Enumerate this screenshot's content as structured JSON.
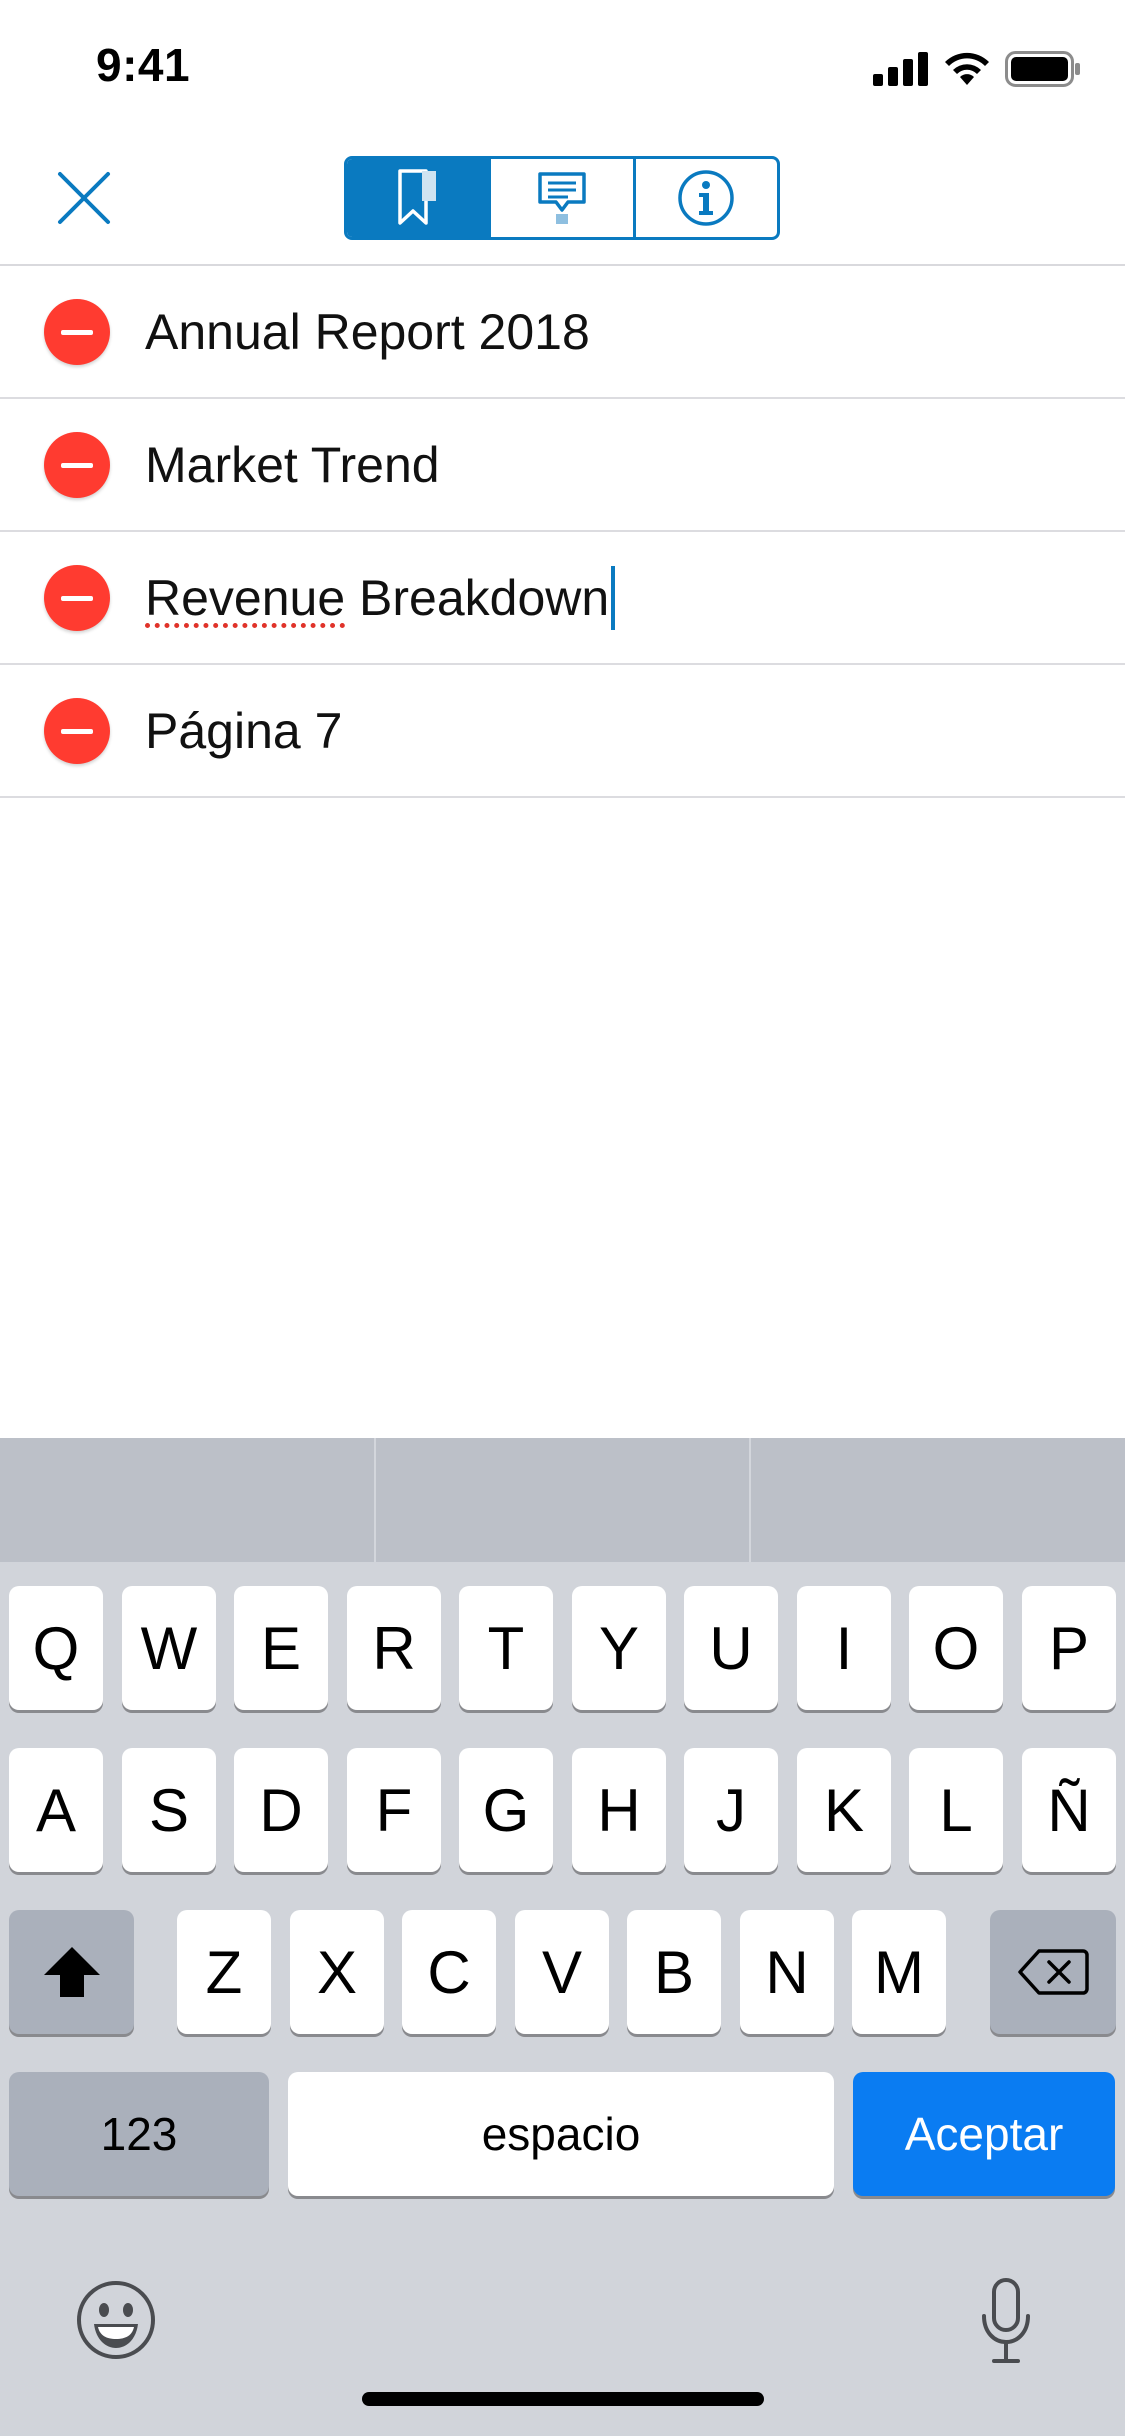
{
  "status_bar": {
    "time": "9:41"
  },
  "nav": {
    "close_icon": "close-icon",
    "tabs": [
      {
        "name": "bookmarks",
        "icon": "bookmark-icon",
        "active": true
      },
      {
        "name": "annotations",
        "icon": "annotation-icon",
        "active": false
      },
      {
        "name": "info",
        "icon": "info-icon",
        "active": false
      }
    ],
    "accent_color": "#0a7ac0"
  },
  "bookmarks": [
    {
      "title": "Annual Report 2018"
    },
    {
      "title": "Market Trend"
    },
    {
      "title": "Revenue Breakdown",
      "editing": true,
      "misspelled_word": "Revenue",
      "rest": " Breakdown"
    },
    {
      "title": "Página 7"
    }
  ],
  "keyboard": {
    "row1": [
      "Q",
      "W",
      "E",
      "R",
      "T",
      "Y",
      "U",
      "I",
      "O",
      "P"
    ],
    "row2": [
      "A",
      "S",
      "D",
      "F",
      "G",
      "H",
      "J",
      "K",
      "L",
      "Ñ"
    ],
    "row3": [
      "Z",
      "X",
      "C",
      "V",
      "B",
      "N",
      "M"
    ],
    "numbers_label": "123",
    "space_label": "espacio",
    "return_label": "Aceptar",
    "shift_icon": "shift-icon",
    "delete_icon": "delete-icon",
    "emoji_icon": "emoji-icon",
    "mic_icon": "microphone-icon",
    "return_color": "#0a7cf2"
  }
}
